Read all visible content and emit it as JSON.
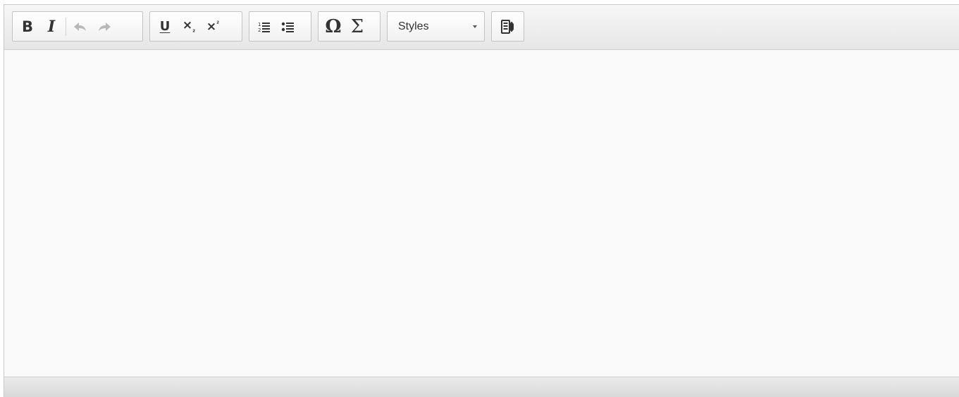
{
  "toolbar": {
    "group1": {
      "bold": {
        "icon": "bold-icon",
        "glyph": "B",
        "disabled": false
      },
      "italic": {
        "icon": "italic-icon",
        "glyph": "I",
        "disabled": false
      },
      "undo": {
        "icon": "undo-icon",
        "disabled": true
      },
      "redo": {
        "icon": "redo-icon",
        "disabled": true
      }
    },
    "group2": {
      "underline": {
        "icon": "underline-icon",
        "glyph": "U"
      },
      "subscript": {
        "icon": "subscript-icon",
        "glyph": "x",
        "sub": "2"
      },
      "superscript": {
        "icon": "superscript-icon",
        "glyph": "x",
        "sup": "2"
      }
    },
    "group3": {
      "numbered_list": {
        "icon": "numbered-list-icon"
      },
      "bulleted_list": {
        "icon": "bulleted-list-icon"
      }
    },
    "group4": {
      "special_char": {
        "icon": "omega-icon",
        "glyph": "Ω"
      },
      "math": {
        "icon": "sigma-icon",
        "glyph": "Σ"
      }
    },
    "styles": {
      "label": "Styles"
    },
    "group5": {
      "extra": {
        "icon": "source-toggle-icon"
      }
    }
  },
  "colors": {
    "toolbar_bg": "#eeeeee",
    "content_bg": "#fafafa",
    "icon": "#333333",
    "icon_disabled": "#b8b8b8"
  }
}
